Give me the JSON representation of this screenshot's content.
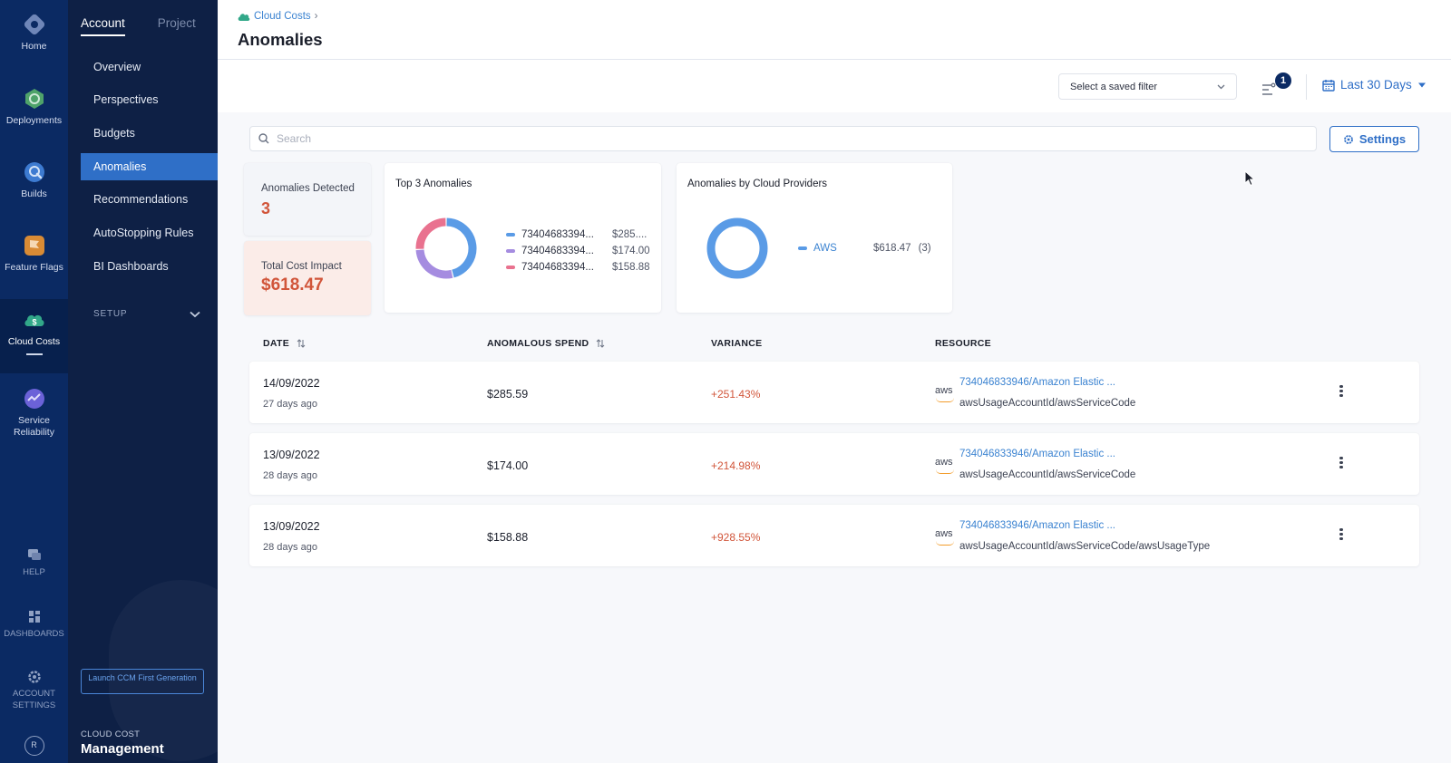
{
  "module_nav": {
    "items": [
      {
        "label": "Home"
      },
      {
        "label": "Deployments"
      },
      {
        "label": "Builds"
      },
      {
        "label": "Feature Flags"
      },
      {
        "label": "Cloud Costs"
      },
      {
        "label": "Service Reliability"
      }
    ],
    "bottom": [
      {
        "label": "HELP"
      },
      {
        "label": "DASHBOARDS"
      },
      {
        "label": "ACCOUNT SETTINGS"
      }
    ],
    "avatar_initial": "R"
  },
  "sub_nav": {
    "tabs": [
      "Account",
      "Project"
    ],
    "items": [
      "Overview",
      "Perspectives",
      "Budgets",
      "Anomalies",
      "Recommendations",
      "AutoStopping Rules",
      "BI Dashboards"
    ],
    "setup_label": "SETUP",
    "launch_label": "Launch CCM First Generation",
    "footer_small": "CLOUD COST",
    "footer_big": "Management"
  },
  "header": {
    "breadcrumb": "Cloud Costs",
    "breadcrumb_sep": "›",
    "title": "Anomalies"
  },
  "toolbar": {
    "saved_filter_placeholder": "Select a saved filter",
    "filter_count": "1",
    "date_range": "Last 30 Days"
  },
  "search": {
    "placeholder": "Search"
  },
  "settings_label": "Settings",
  "summary": {
    "detected_label": "Anomalies Detected",
    "detected_value": "3",
    "impact_label": "Total Cost Impact",
    "impact_value": "$618.47"
  },
  "top3": {
    "title": "Top 3 Anomalies",
    "entries": [
      {
        "name": "73404683394...",
        "amount": "$285....",
        "color": "#5a9be6",
        "share": 285.59
      },
      {
        "name": "73404683394...",
        "amount": "$174.00",
        "color": "#a58ce0",
        "share": 174.0
      },
      {
        "name": "73404683394...",
        "amount": "$158.88",
        "color": "#e9728f",
        "share": 158.88
      }
    ]
  },
  "providers": {
    "title": "Anomalies by Cloud Providers",
    "entries": [
      {
        "name": "AWS",
        "amount": "$618.47",
        "count": "(3)",
        "color": "#5a9be6",
        "share": 1
      }
    ]
  },
  "table": {
    "columns": [
      "DATE",
      "ANOMALOUS SPEND",
      "VARIANCE",
      "RESOURCE"
    ],
    "rows": [
      {
        "date": "14/09/2022",
        "ago": "27 days ago",
        "spend": "$285.59",
        "variance": "+251.43%",
        "provider": "aws",
        "resource": "734046833946/Amazon Elastic ...",
        "resource_sub": "awsUsageAccountId/awsServiceCode"
      },
      {
        "date": "13/09/2022",
        "ago": "28 days ago",
        "spend": "$174.00",
        "variance": "+214.98%",
        "provider": "aws",
        "resource": "734046833946/Amazon Elastic ...",
        "resource_sub": "awsUsageAccountId/awsServiceCode"
      },
      {
        "date": "13/09/2022",
        "ago": "28 days ago",
        "spend": "$158.88",
        "variance": "+928.55%",
        "provider": "aws",
        "resource": "734046833946/Amazon Elastic ...",
        "resource_sub": "awsUsageAccountId/awsServiceCode/awsUsageType"
      }
    ]
  }
}
